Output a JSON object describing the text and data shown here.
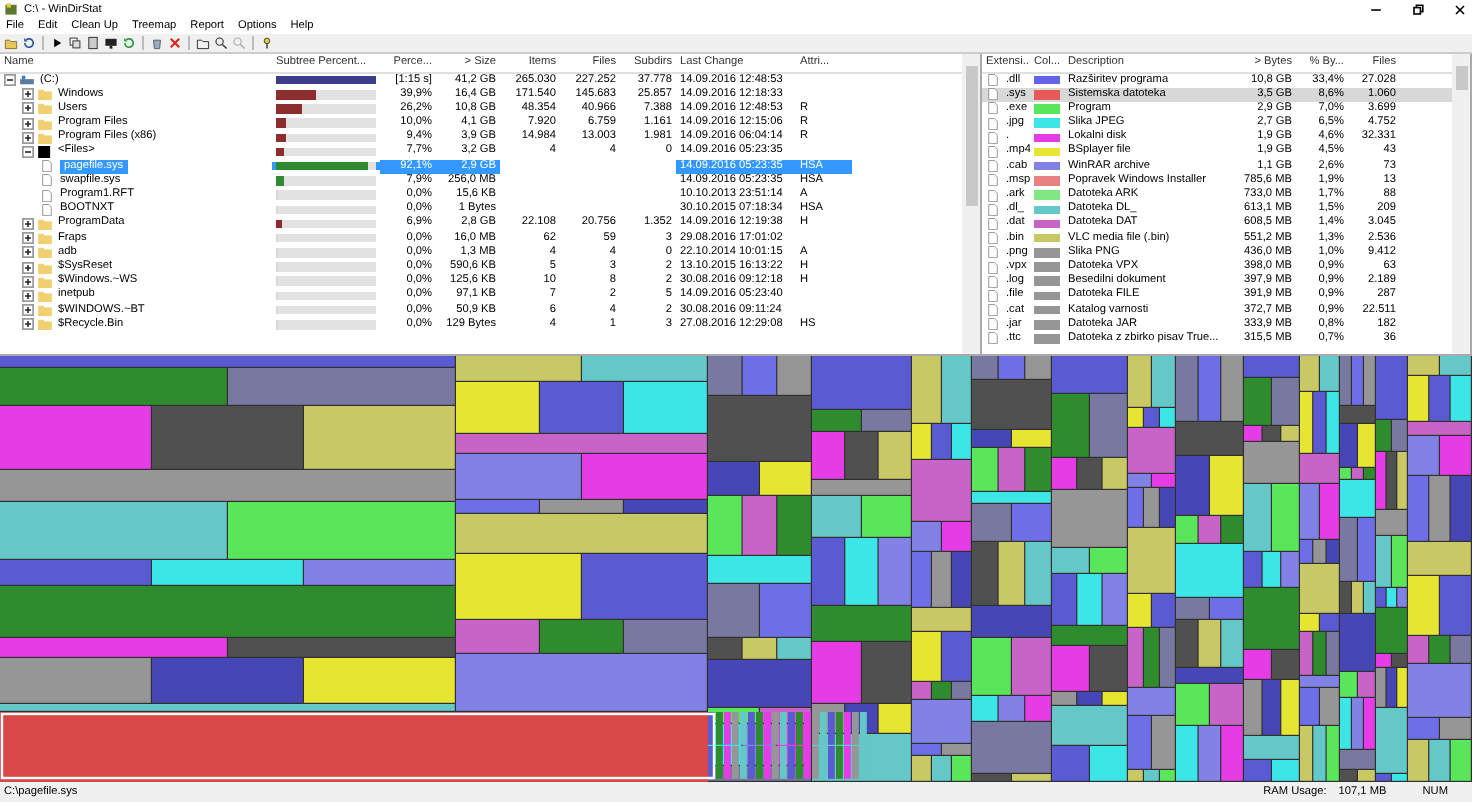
{
  "window": {
    "title": "C:\\ - WinDirStat"
  },
  "menu": [
    "File",
    "Edit",
    "Clean Up",
    "Treemap",
    "Report",
    "Options",
    "Help"
  ],
  "tree_columns": [
    "Name",
    "Subtree Percent...",
    "Perce...",
    "> Size",
    "Items",
    "Files",
    "Subdirs",
    "Last Change",
    "Attri..."
  ],
  "tree": [
    {
      "name": "(C:)",
      "kind": "drive",
      "expanded": true,
      "selected": false,
      "level": 1,
      "percent": "[1:15 s]",
      "size": "41,2 GB",
      "items": "265.030",
      "files": "227.252",
      "subdirs": "37.778",
      "last_change": "14.09.2016 12:48:53",
      "children": [
        {
          "name": "Windows",
          "kind": "folder",
          "expanded": false,
          "selected": false,
          "level": 0.399,
          "percent": "39,9%",
          "size": "16,4 GB",
          "items": "171.540",
          "files": "145.683",
          "subdirs": "25.857",
          "last_change": "14.09.2016 12:18:33"
        },
        {
          "name": "Users",
          "kind": "folder",
          "expanded": false,
          "selected": false,
          "level": 0.262,
          "percent": "26,2%",
          "size": "10,8 GB",
          "items": "48.354",
          "files": "40.966",
          "subdirs": "7.388",
          "last_change": "14.09.2016 12:48:53",
          "attributes": "R"
        },
        {
          "name": "Program Files",
          "kind": "folder",
          "expanded": false,
          "selected": false,
          "level": 0.1,
          "percent": "10,0%",
          "size": "4,1 GB",
          "items": "7.920",
          "files": "6.759",
          "subdirs": "1.161",
          "last_change": "14.09.2016 12:15:06",
          "attributes": "R"
        },
        {
          "name": "Program Files (x86)",
          "kind": "folder",
          "expanded": false,
          "selected": false,
          "level": 0.094,
          "percent": "9,4%",
          "size": "3,9 GB",
          "items": "14.984",
          "files": "13.003",
          "subdirs": "1.981",
          "last_change": "14.09.2016 06:04:14",
          "attributes": "R"
        },
        {
          "name": "<Files>",
          "kind": "files",
          "expanded": true,
          "selected": false,
          "level": 0.077,
          "percent": "7,7%",
          "size": "3,2 GB",
          "items": "4",
          "files": "4",
          "subdirs": "0",
          "last_change": "14.09.2016 05:23:35",
          "children": [
            {
              "name": "pagefile.sys",
              "kind": "file",
              "selected": true,
              "level": 0.921,
              "percent": "92,1%",
              "size": "2,9 GB",
              "last_change": "14.09.2016 05:23:35",
              "attributes": "HSA"
            },
            {
              "name": "swapfile.sys",
              "kind": "file",
              "selected": false,
              "level": 0.079,
              "percent": "7,9%",
              "size": "256,0 MB",
              "last_change": "14.09.2016 05:23:35",
              "attributes": "HSA"
            },
            {
              "name": "Program1.RFT",
              "kind": "file",
              "selected": false,
              "level": 0,
              "percent": "0,0%",
              "size": "15,6 KB",
              "last_change": "10.10.2013 23:51:14",
              "attributes": "A"
            },
            {
              "name": "BOOTNXT",
              "kind": "file",
              "selected": false,
              "level": 0,
              "percent": "0,0%",
              "size": "1 Bytes",
              "last_change": "30.10.2015 07:18:34",
              "attributes": "HSA"
            }
          ]
        },
        {
          "name": "ProgramData",
          "kind": "folder",
          "expanded": false,
          "selected": false,
          "level": 0.069,
          "percent": "6,9%",
          "size": "2,8 GB",
          "items": "22.108",
          "files": "20.756",
          "subdirs": "1.352",
          "last_change": "14.09.2016 12:19:38",
          "attributes": "H"
        },
        {
          "name": "Fraps",
          "kind": "folder",
          "expanded": false,
          "selected": false,
          "level": 0,
          "percent": "0,0%",
          "size": "16,0 MB",
          "items": "62",
          "files": "59",
          "subdirs": "3",
          "last_change": "29.08.2016 17:01:02"
        },
        {
          "name": "adb",
          "kind": "folder",
          "expanded": false,
          "selected": false,
          "level": 0,
          "percent": "0,0%",
          "size": "1,3 MB",
          "items": "4",
          "files": "4",
          "subdirs": "0",
          "last_change": "22.10.2014 10:01:15",
          "attributes": "A"
        },
        {
          "name": "$SysReset",
          "kind": "folder",
          "expanded": false,
          "selected": false,
          "level": 0,
          "percent": "0,0%",
          "size": "590,6 KB",
          "items": "5",
          "files": "3",
          "subdirs": "2",
          "last_change": "13.10.2015 16:13:22",
          "attributes": "H"
        },
        {
          "name": "$Windows.~WS",
          "kind": "folder",
          "expanded": false,
          "selected": false,
          "level": 0,
          "percent": "0,0%",
          "size": "125,6 KB",
          "items": "10",
          "files": "8",
          "subdirs": "2",
          "last_change": "30.08.2016 09:12:18",
          "attributes": "H"
        },
        {
          "name": "inetpub",
          "kind": "folder",
          "expanded": false,
          "selected": false,
          "level": 0,
          "percent": "0,0%",
          "size": "97,1 KB",
          "items": "7",
          "files": "2",
          "subdirs": "5",
          "last_change": "14.09.2016 05:23:40"
        },
        {
          "name": "$WINDOWS.~BT",
          "kind": "folder",
          "expanded": false,
          "selected": false,
          "level": 0,
          "percent": "0,0%",
          "size": "50,9 KB",
          "items": "6",
          "files": "4",
          "subdirs": "2",
          "last_change": "30.08.2016 09:11:24"
        },
        {
          "name": "$Recycle.Bin",
          "kind": "folder",
          "expanded": false,
          "selected": false,
          "level": 0,
          "percent": "0,0%",
          "size": "129 Bytes",
          "items": "4",
          "files": "1",
          "subdirs": "3",
          "last_change": "27.08.2016 12:29:08",
          "attributes": "HS"
        }
      ]
    }
  ],
  "ext_columns": [
    "Extensi...",
    "Col...",
    "Description",
    "> Bytes",
    "% By...",
    "Files"
  ],
  "extensions": [
    {
      "ext": ".dll",
      "color": "#6464e6",
      "description": "Razširitev programa",
      "bytes": "10,8 GB",
      "percent": "33,4%",
      "files": "27.028",
      "selected": false
    },
    {
      "ext": ".sys",
      "color": "#e65a5a",
      "description": "Sistemska datoteka",
      "bytes": "3,5 GB",
      "percent": "8,6%",
      "files": "1.060",
      "selected": true
    },
    {
      "ext": ".exe",
      "color": "#5ae65a",
      "description": "Program",
      "bytes": "2,9 GB",
      "percent": "7,0%",
      "files": "3.699",
      "selected": false
    },
    {
      "ext": ".jpg",
      "color": "#3ce6e6",
      "description": "Slika JPEG",
      "bytes": "2,7 GB",
      "percent": "6,5%",
      "files": "4.752",
      "selected": false
    },
    {
      "ext": ".",
      "color": "#e63ce6",
      "description": "Lokalni disk",
      "bytes": "1,9 GB",
      "percent": "4,6%",
      "files": "32.331",
      "selected": false
    },
    {
      "ext": ".mp4",
      "color": "#e6e632",
      "description": "BSplayer file",
      "bytes": "1,9 GB",
      "percent": "4,5%",
      "files": "43",
      "selected": false
    },
    {
      "ext": ".cab",
      "color": "#8282e6",
      "description": "WinRAR archive",
      "bytes": "1,1 GB",
      "percent": "2,6%",
      "files": "73",
      "selected": false
    },
    {
      "ext": ".msp",
      "color": "#e68282",
      "description": "Popravek Windows Installer",
      "bytes": "785,6 MB",
      "percent": "1,9%",
      "files": "13",
      "selected": false
    },
    {
      "ext": ".ark",
      "color": "#82e682",
      "description": "Datoteka ARK",
      "bytes": "733,0 MB",
      "percent": "1,7%",
      "files": "88",
      "selected": false
    },
    {
      "ext": ".dl_",
      "color": "#64c8c8",
      "description": "Datoteka DL_",
      "bytes": "613,1 MB",
      "percent": "1,5%",
      "files": "209",
      "selected": false
    },
    {
      "ext": ".dat",
      "color": "#c864c8",
      "description": "Datoteka DAT",
      "bytes": "608,5 MB",
      "percent": "1,4%",
      "files": "3.045",
      "selected": false
    },
    {
      "ext": ".bin",
      "color": "#c8c864",
      "description": "VLC media file (.bin)",
      "bytes": "551,2 MB",
      "percent": "1,3%",
      "files": "2.536",
      "selected": false
    },
    {
      "ext": ".png",
      "color": "#969696",
      "description": "Slika PNG",
      "bytes": "436,0 MB",
      "percent": "1,0%",
      "files": "9.412",
      "selected": false
    },
    {
      "ext": ".vpx",
      "color": "#969696",
      "description": "Datoteka VPX",
      "bytes": "398,0 MB",
      "percent": "0,9%",
      "files": "63",
      "selected": false
    },
    {
      "ext": ".log",
      "color": "#969696",
      "description": "Besedilni dokument",
      "bytes": "397,9 MB",
      "percent": "0,9%",
      "files": "2.189",
      "selected": false
    },
    {
      "ext": ".file",
      "color": "#969696",
      "description": "Datoteka FILE",
      "bytes": "391,9 MB",
      "percent": "0,9%",
      "files": "287",
      "selected": false
    },
    {
      "ext": ".cat",
      "color": "#969696",
      "description": "Katalog varnosti",
      "bytes": "372,7 MB",
      "percent": "0,9%",
      "files": "22.511",
      "selected": false
    },
    {
      "ext": ".jar",
      "color": "#969696",
      "description": "Datoteka JAR",
      "bytes": "333,9 MB",
      "percent": "0,8%",
      "files": "182",
      "selected": false
    },
    {
      "ext": ".ttc",
      "color": "#969696",
      "description": "Datoteka z zbirko pisav True...",
      "bytes": "315,5 MB",
      "percent": "0,7%",
      "files": "36",
      "selected": false
    }
  ],
  "status_bar": {
    "path": "C:\\pagefile.sys",
    "ram_label": "RAM Usage:",
    "ram_value": "107,1 MB",
    "num": "NUM"
  }
}
